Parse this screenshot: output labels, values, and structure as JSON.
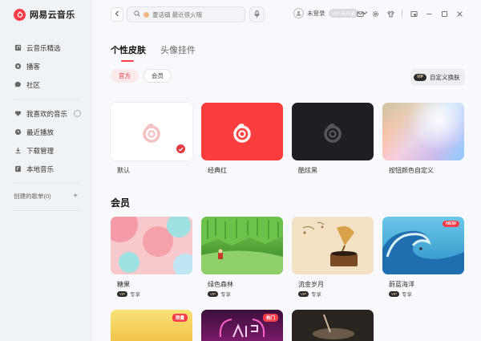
{
  "app": {
    "name": "网易云音乐"
  },
  "sidebar": {
    "main_items": [
      {
        "label": "云音乐精选",
        "icon": "music-note-icon"
      },
      {
        "label": "播客",
        "icon": "podcast-icon"
      },
      {
        "label": "社区",
        "icon": "chat-icon"
      }
    ],
    "my_items": [
      {
        "label": "我喜欢的音乐",
        "icon": "heart-icon"
      },
      {
        "label": "最近播放",
        "icon": "clock-icon"
      },
      {
        "label": "下载管理",
        "icon": "download-icon"
      },
      {
        "label": "本地音乐",
        "icon": "music-file-icon"
      }
    ],
    "playlist_header": "创建的歌单(0)"
  },
  "topbar": {
    "search_placeholder": "童话镇 最近很火哦",
    "user_status": "未登录",
    "vip_pill": "VIP·未开通"
  },
  "tabs": [
    {
      "label": "个性皮肤",
      "active": true
    },
    {
      "label": "头像挂件",
      "active": false
    }
  ],
  "filters": [
    {
      "label": "官方",
      "active": true
    },
    {
      "label": "会员",
      "active": false
    }
  ],
  "custom_button": {
    "label": "自定义换肤",
    "badge": "VIP"
  },
  "official_skins": [
    {
      "label": "默认",
      "bg": "#ffffff",
      "logo_color": "#f5c2c4",
      "selected": true
    },
    {
      "label": "经典红",
      "bg": "#fc3d3d",
      "logo_color": "#ffffff",
      "selected": false
    },
    {
      "label": "酷炫黑",
      "bg": "#1e1e24",
      "logo_color": "#55555c",
      "selected": false
    },
    {
      "label": "按钮颜色自定义",
      "bg": "gradient",
      "logo_color": "",
      "selected": false
    }
  ],
  "member_section_title": "会员",
  "member_skins": [
    {
      "label": "糖果",
      "sub": "专享",
      "badge": "VIP",
      "tag": ""
    },
    {
      "label": "绿色森林",
      "sub": "专享",
      "badge": "VIP",
      "tag": ""
    },
    {
      "label": "流金岁月",
      "sub": "专享",
      "badge": "VIP",
      "tag": ""
    },
    {
      "label": "蔚蓝海洋",
      "sub": "专享",
      "badge": "VIP",
      "tag": "NEW"
    }
  ],
  "bottom_row_tags": [
    "限量",
    "热门"
  ]
}
